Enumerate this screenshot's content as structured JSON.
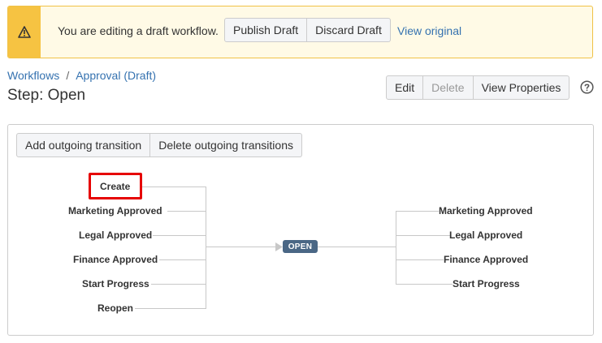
{
  "banner": {
    "message": "You are editing a draft workflow.",
    "publish_label": "Publish Draft",
    "discard_label": "Discard Draft",
    "view_original_label": "View original",
    "icon": "warning-icon"
  },
  "breadcrumb": {
    "items": [
      "Workflows",
      "Approval (Draft)"
    ],
    "separator": "/"
  },
  "page": {
    "title": "Step: Open"
  },
  "header_actions": {
    "edit_label": "Edit",
    "delete_label": "Delete",
    "view_properties_label": "View Properties",
    "help_icon": "help-icon"
  },
  "panel": {
    "add_label": "Add outgoing transition",
    "delete_label": "Delete outgoing transitions"
  },
  "diagram": {
    "incoming": [
      "Create",
      "Marketing Approved",
      "Legal Approved",
      "Finance Approved",
      "Start Progress",
      "Reopen"
    ],
    "status": "OPEN",
    "outgoing": [
      "Marketing Approved",
      "Legal Approved",
      "Finance Approved",
      "Start Progress"
    ],
    "highlighted": "Create"
  },
  "colors": {
    "banner_bg": "#fffae6",
    "banner_side": "#f6c342",
    "link": "#3572b0",
    "status_bg": "#4a6785",
    "highlight": "#e60000"
  }
}
